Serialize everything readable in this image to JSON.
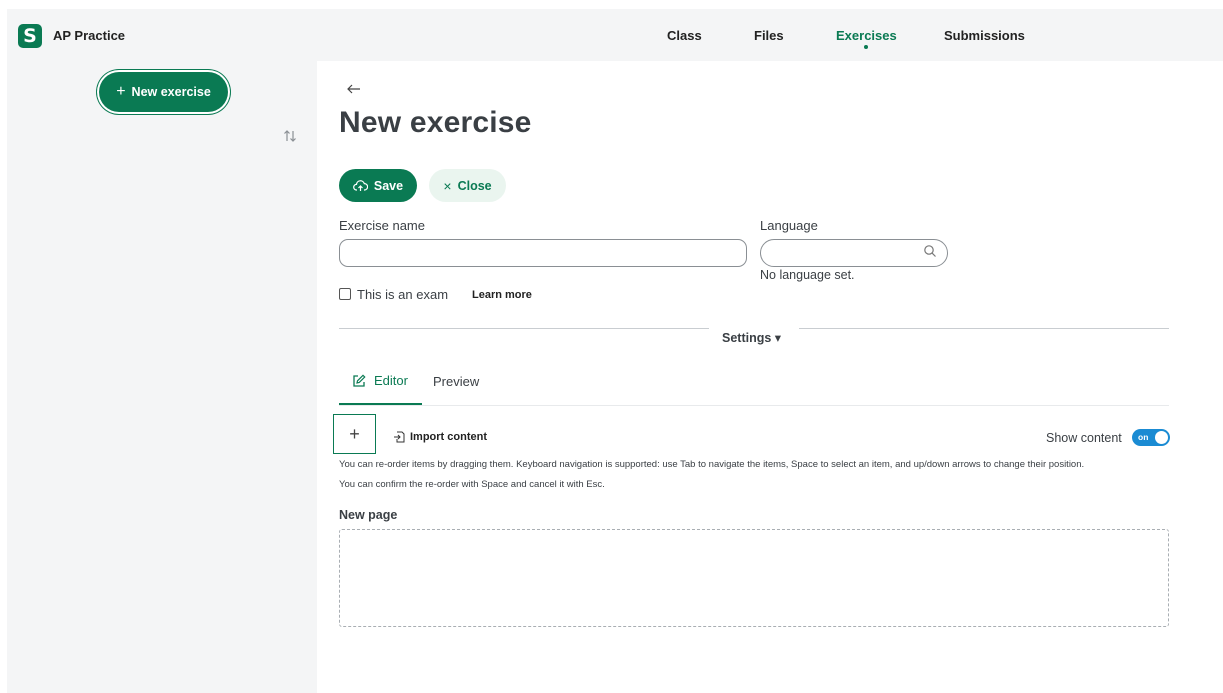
{
  "app": {
    "name": "AP Practice",
    "logo_letter": "S"
  },
  "nav": {
    "items": [
      {
        "label": "Class"
      },
      {
        "label": "Files"
      },
      {
        "label": "Exercises"
      },
      {
        "label": "Submissions"
      }
    ],
    "active": "Exercises"
  },
  "sidebar": {
    "new_exercise_label": "New exercise"
  },
  "main": {
    "title": "New exercise",
    "save_label": "Save",
    "close_label": "Close",
    "exercise_name_label": "Exercise name",
    "exercise_name_value": "",
    "language_label": "Language",
    "language_value": "",
    "language_hint": "No language set.",
    "exam_label": "This is an exam",
    "exam_checked": false,
    "learn_more_label": "Learn more",
    "settings_label": "Settings ▾",
    "tabs": [
      {
        "label": "Editor",
        "active": true
      },
      {
        "label": "Preview",
        "active": false
      }
    ],
    "import_label": "Import content",
    "show_content_label": "Show content",
    "toggle_label": "on",
    "help_line1": "You can re-order items by dragging them. Keyboard navigation is supported: use Tab to navigate the items, Space to select an item, and up/down arrows to change their position.",
    "help_line2": "You can confirm the re-order with Space and cancel it with Esc.",
    "new_page_label": "New page"
  },
  "colors": {
    "accent": "#0a7a53",
    "toggle": "#1a8bd3",
    "sidebar_bg": "#f4f5f6"
  }
}
